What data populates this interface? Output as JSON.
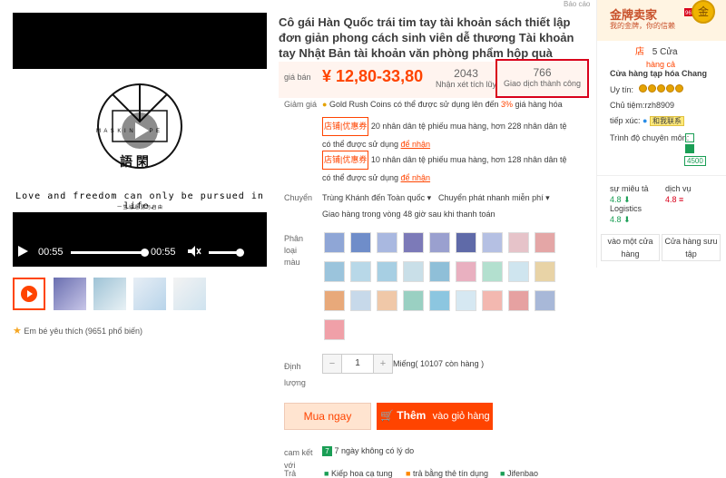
{
  "report": "Báo cáo",
  "player": {
    "tagline": "Love and freedom can only be pursued in life.",
    "subtagline": "一 生 追 逐 爱 与 自 由",
    "logo_brand": "M A S K I N   T A P E",
    "logo_chars": "語  閑",
    "time_current": "00:55",
    "time_total": "00:55",
    "progress_fraction": 0.98
  },
  "favorite": {
    "text": "Em bé yêu thích (9651 phổ biến)"
  },
  "product": {
    "title": "Cô gái Hàn Quốc trái tim tay tài khoản sách thiết lập đơn giản phong cách sinh viên dễ thương Tài khoản tay Nhật Bản tài khoản văn phòng phẩm hộp quà"
  },
  "price": {
    "label": "giá bán",
    "value": "¥ 12,80-33,80",
    "reviews_count": "2043",
    "reviews_label": "Nhận xét tích lũy",
    "txn_count": "766",
    "txn_label": "Giao dịch thành công"
  },
  "discount": {
    "label": "Giảm giá",
    "gold": "Gold Rush Coins có thể được sử dụng lên đến ",
    "gold_pct": "3%",
    "gold_tail": " giá hàng hóa",
    "coupon_tag": "店铺",
    "coupon_tag2": "优惠券",
    "coupon1": "20 nhân dân tệ phiếu mua hàng, hơn 228 nhân dân tệ có thể được sử dụng",
    "coupon2": "10 nhân dân tệ phiếu mua hàng, hơn 128 nhân dân tệ có thể được sử dụng",
    "get": "để nhận"
  },
  "shipping": {
    "label": "Chuyển",
    "route": "Trùng Khánh đến Toàn quốc",
    "express": "Chuyển phát nhanh miễn phí",
    "eta": "Giao hàng trong vòng 48 giờ sau khi thanh toán"
  },
  "variant": {
    "label": "Phân loại màu"
  },
  "quantity": {
    "label": "Định lượng",
    "minus": "−",
    "value": "1",
    "plus": "+",
    "stock": "Miếng( 10107 còn hàng )"
  },
  "actions": {
    "buy": "Mua ngay",
    "cart_bold": "Thêm",
    "cart_rest": "vào giỏ hàng"
  },
  "promise": {
    "label": "cam kết với",
    "item": "7 ngày không có lý do",
    "pay_label": "Trả",
    "pay1": "Kiếp hoa cạ tung",
    "pay2": "trả bằng thẻ tín dụng",
    "pay3": "Jifenbao"
  },
  "seller": {
    "badge_cn": "金牌卖家",
    "badge_sub": "我的金牌，你的信赖",
    "medal": "金",
    "ribbon": "96 打 破 限",
    "stores_icon": "店",
    "stores": "5 Cửa",
    "stores_sub": "hàng cả",
    "name": "Cửa hàng tạp hóa Chang",
    "rep_label": "Uy tín:",
    "owner": "Chủ tiệm:rzh8909",
    "contact_label": "tiếp xúc:",
    "contact_btn": "和我联系",
    "skill_label": "Trình độ chuyên môn:",
    "skill_val": "4500",
    "desc_label": "sự miêu tả",
    "desc_val": "4.8 ⬇",
    "svc_label": "dịch vụ",
    "svc_val": "4.8 ≡",
    "log_label": "Logistics",
    "log_val": "4.8 ⬇",
    "btn_store": "vào một cửa hàng",
    "btn_fav": "Cửa hàng sưu tập"
  }
}
